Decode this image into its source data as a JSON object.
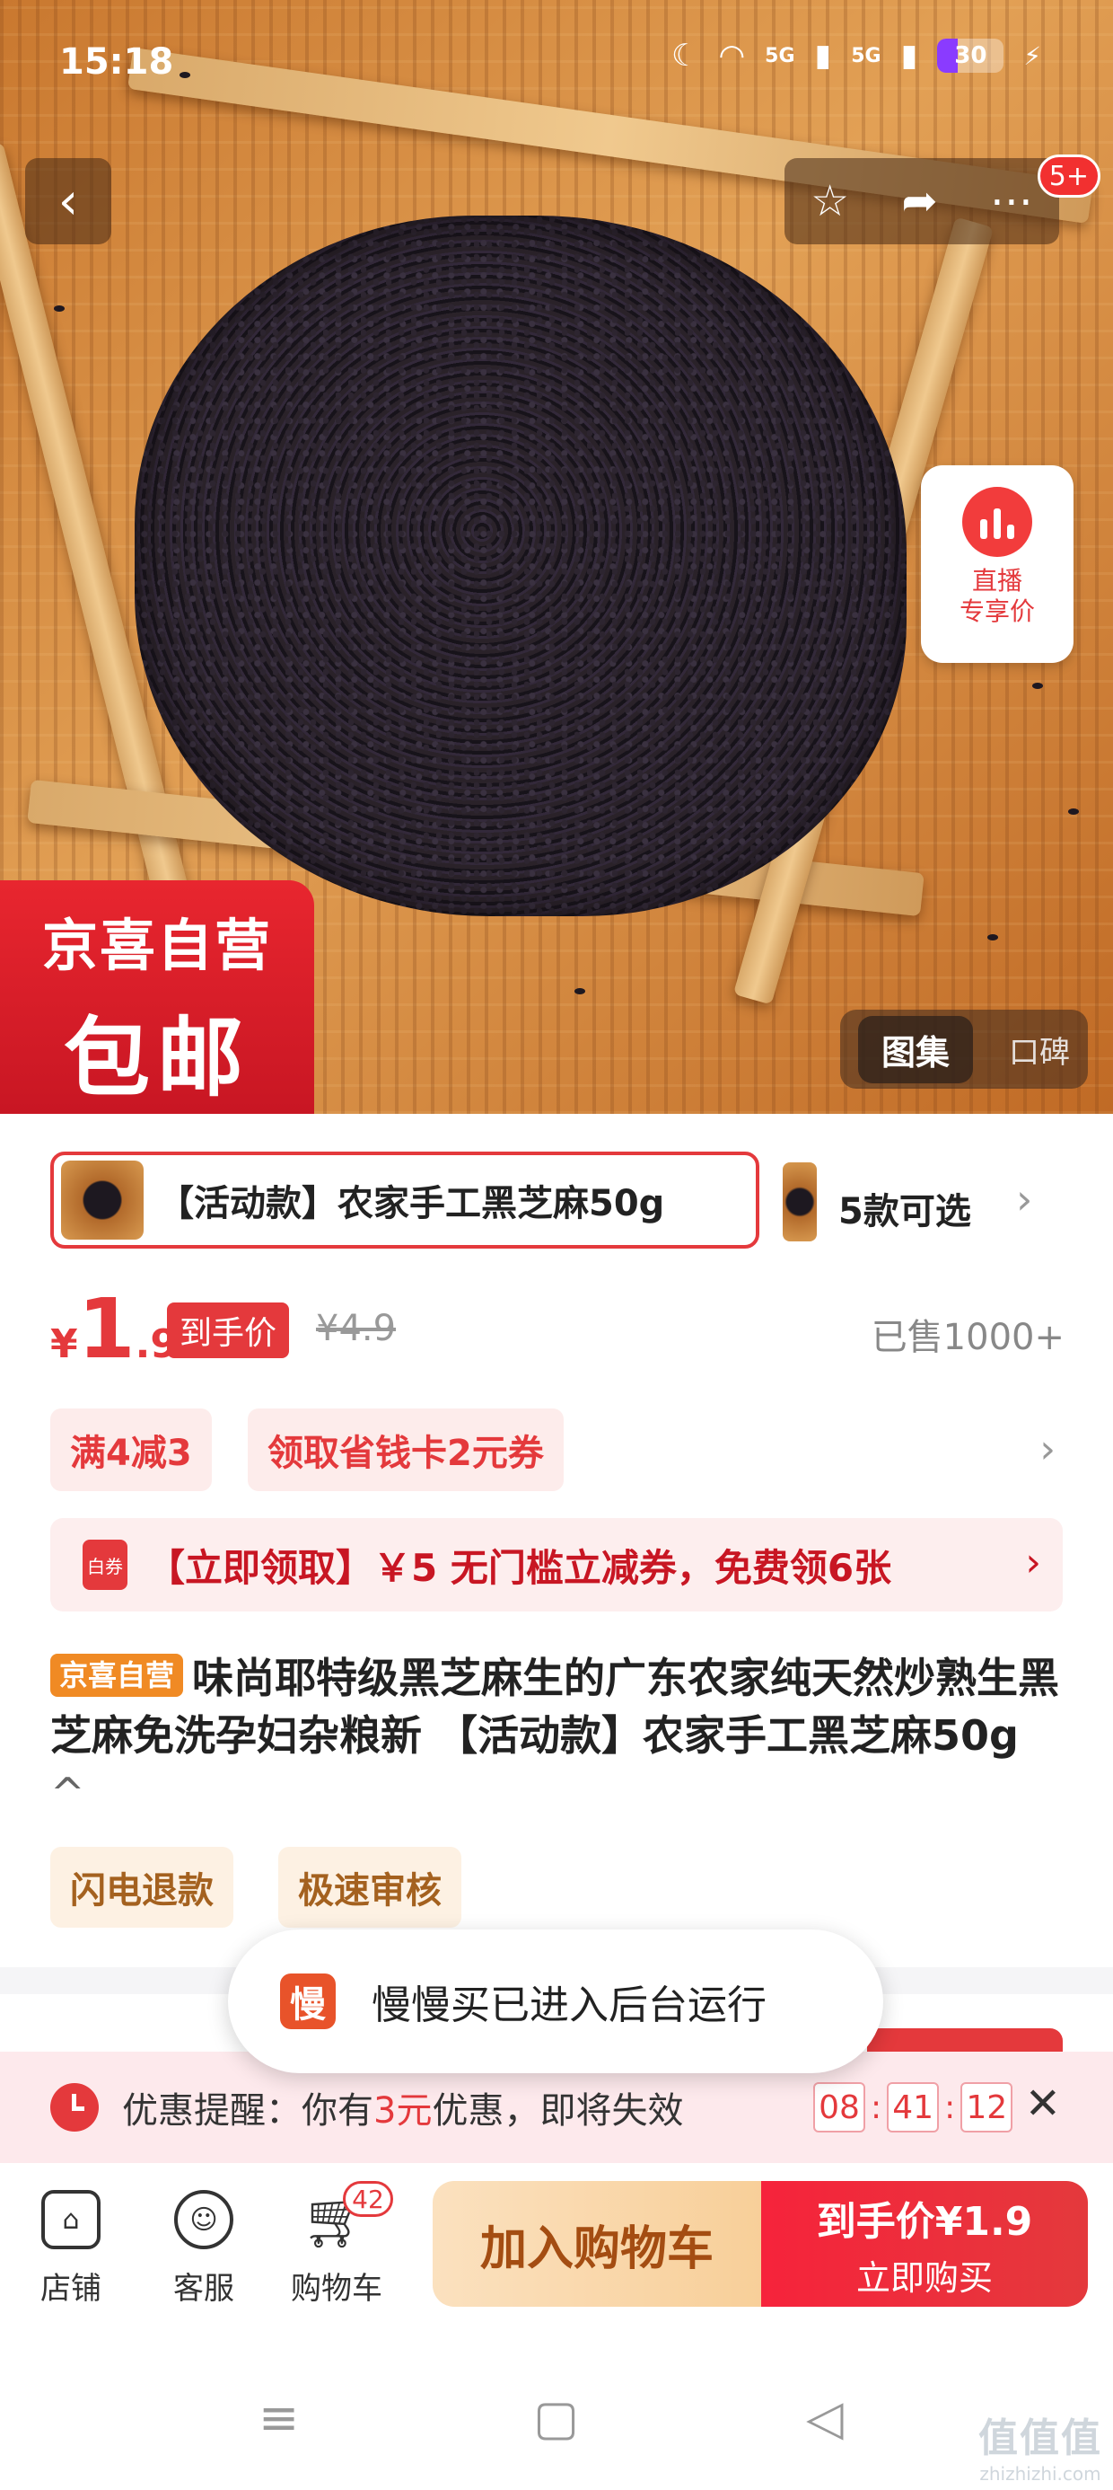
{
  "status_bar": {
    "time": "15:18",
    "network": [
      "5G",
      "5G"
    ],
    "battery_percent": 30,
    "battery_text": "30"
  },
  "nav": {
    "badge": "5+"
  },
  "live_badge": {
    "line1": "直播",
    "line2": "专享价"
  },
  "promo_badge": {
    "line1": "京喜自营",
    "line2": "包邮"
  },
  "gallery_switch": {
    "active": "图集",
    "inactive": "口碑"
  },
  "variant": {
    "selected": "【活动款】农家手工黑芝麻50g",
    "count": "5款可选"
  },
  "price": {
    "currency": "¥",
    "integer": "1",
    "decimal": ".9",
    "tag": "到手价",
    "original": "¥4.9",
    "sold": "已售1000+"
  },
  "coupons": [
    "满4减3",
    "领取省钱卡2元券"
  ],
  "voucher": {
    "icon_text": "白券",
    "text": "【立即领取】￥5 无门槛立减券，免费领6张"
  },
  "title": {
    "tag": "京喜自营",
    "text": "味尚耶特级黑芝麻生的广东农家纯天然炒熟生黑芝麻免洗孕妇杂粮新 【活动款】农家手工黑芝麻50g",
    "caret": "^"
  },
  "services": [
    "闪电退款",
    "极速审核"
  ],
  "toast": {
    "icon": "慢",
    "text": "慢慢买已进入后台运行"
  },
  "reminder": {
    "prefix": "优惠提醒：你有",
    "highlight": "3元",
    "suffix": "优惠，即将失效",
    "timer": [
      "08",
      "41",
      "12"
    ]
  },
  "bottom_bar": {
    "shop": "店铺",
    "service": "客服",
    "cart": "购物车",
    "cart_count": "42",
    "add_to_cart": "加入购物车",
    "buy_price": "到手价¥1.9",
    "buy_now": "立即购买"
  },
  "watermark": {
    "logo": "值值值",
    "url": "zhizhizhi.com"
  },
  "colors": {
    "accent": "#e4393c",
    "toast_icon": "#e8532a",
    "cart_button": "#f8cf99",
    "title_tag": "#f08a24"
  }
}
